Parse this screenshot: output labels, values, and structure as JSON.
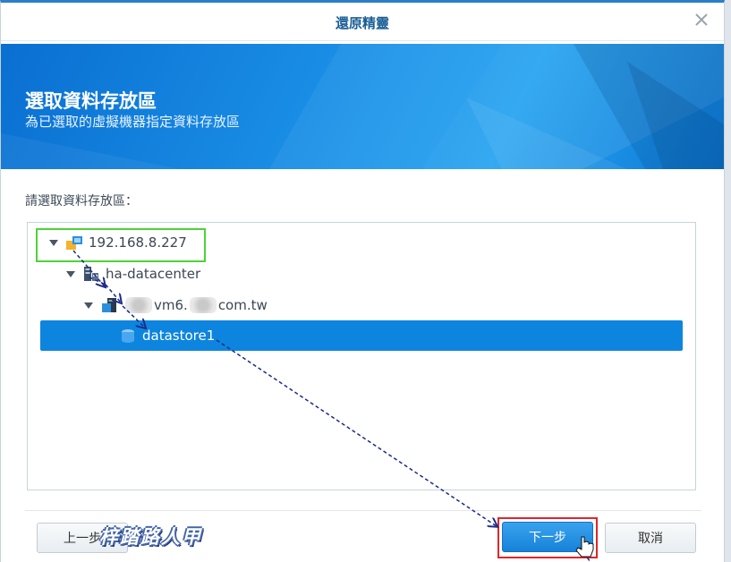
{
  "dialog": {
    "title": "還原精靈",
    "close_icon": "close-icon"
  },
  "banner": {
    "heading": "選取資料存放區",
    "subheading": "為已選取的虛擬機器指定資料存放區"
  },
  "prompt": "請選取資料存放區：",
  "tree": {
    "nodes": [
      {
        "label": "192.168.8.227",
        "icon": "host-icon",
        "expanded": true
      },
      {
        "label": "ha-datacenter",
        "icon": "datacenter-icon",
        "expanded": true
      },
      {
        "label": "vm6.",
        "label_suffix": "com.tw",
        "icon": "server-icon",
        "expanded": true
      },
      {
        "label": "datastore1",
        "icon": "datastore-icon",
        "selected": true
      }
    ]
  },
  "footer": {
    "prev_label": "上一步",
    "next_label": "下一步",
    "cancel_label": "取消"
  },
  "watermark": "梓踏路人甲",
  "colors": {
    "accent": "#0d85de",
    "title": "#1a5e96",
    "highlight_green": "#4cd437",
    "highlight_red": "#e0262b"
  }
}
